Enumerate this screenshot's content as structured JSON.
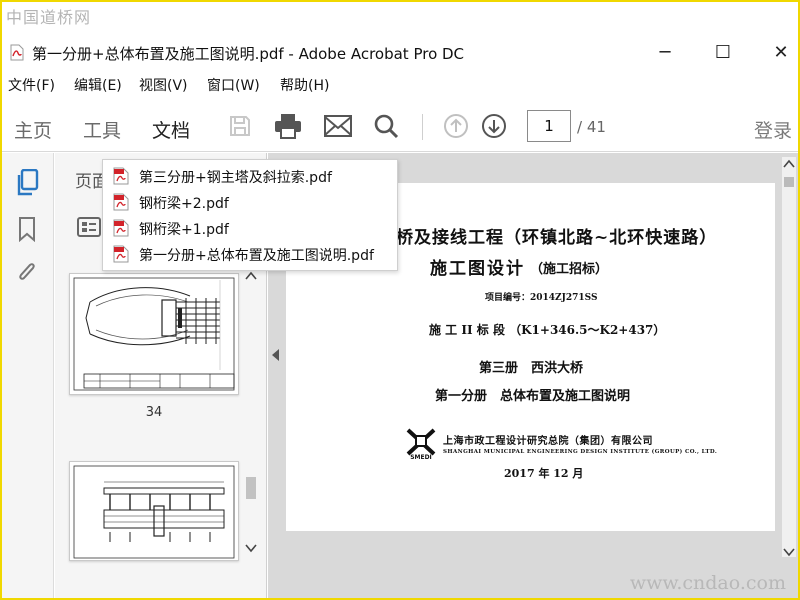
{
  "watermark": {
    "top": "中国道桥网",
    "bottom": "www.cndao.com"
  },
  "window": {
    "title": "第一分册+总体布置及施工图说明.pdf - Adobe Acrobat Pro DC",
    "controls": [
      "─",
      "☐",
      "✕"
    ]
  },
  "menu": [
    "文件(F)",
    "编辑(E)",
    "视图(V)",
    "窗口(W)",
    "帮助(H)"
  ],
  "toolbar": {
    "tabs": [
      "主页",
      "工具",
      "文档"
    ],
    "active_tab": "文档",
    "page_current": "1",
    "page_total": "/ 41",
    "login": "登录"
  },
  "left_rail": {
    "icons": [
      "pages-icon",
      "bookmark-icon",
      "attachment-icon"
    ]
  },
  "thumbnails": {
    "pane_title": "页面",
    "items": [
      {
        "label": "34"
      },
      {
        "label": ""
      }
    ]
  },
  "recent_files": [
    "第三分册+钢主塔及斜拉索.pdf",
    "钢桁梁+2.pdf",
    "钢桁梁+1.pdf",
    "第一分册+总体布置及施工图说明.pdf"
  ],
  "document": {
    "line1": "桥及接线工程（环镇北路~北环快速路）",
    "line2": "施工图设计",
    "line2_sub": "（施工招标）",
    "project_no": "项目编号：2014ZJ271SS",
    "section": "施 工 II 标 段 （K1+346.5～K2+437）",
    "volume": "第三册　西洪大桥",
    "book": "第一分册　总体布置及施工图说明",
    "company_cn": "上海市政工程设计研究总院（集团）有限公司",
    "company_en": "SHANGHAI MUNICIPAL ENGINEERING DESIGN INSTITUTE (GROUP) CO., LTD.",
    "logo_text": "SMEDI",
    "date": "2017 年 12 月"
  },
  "colors": {
    "pdf_red": "#d2232a",
    "frame": "#f0d800"
  }
}
